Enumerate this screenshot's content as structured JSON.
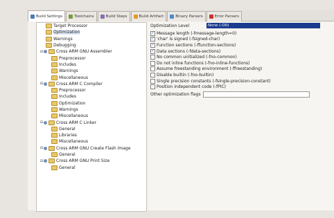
{
  "tabs": [
    {
      "label": "Build Settings",
      "icon": "gear-icon",
      "color": "#4a7ab5",
      "active": true
    },
    {
      "label": "Toolchains",
      "icon": "toolchain-icon",
      "color": "#7a9a3c",
      "active": false
    },
    {
      "label": "Build Steps",
      "icon": "steps-icon",
      "color": "#8b6db0",
      "active": false
    },
    {
      "label": "Build Artifact",
      "icon": "artifact-icon",
      "color": "#e39a2b",
      "active": false
    },
    {
      "label": "Binary Parsers",
      "icon": "binary-icon",
      "color": "#4f8ac7",
      "active": false
    },
    {
      "label": "Error Parsers",
      "icon": "error-icon",
      "color": "#c8322e",
      "active": false
    }
  ],
  "tree": [
    {
      "label": "Target Processor",
      "depth": 1,
      "expander": ""
    },
    {
      "label": "Optimization",
      "depth": 1,
      "expander": "",
      "selected": true
    },
    {
      "label": "Warnings",
      "depth": 1,
      "expander": ""
    },
    {
      "label": "Debugging",
      "depth": 1,
      "expander": ""
    },
    {
      "label": "Cross ARM GNU Assembler",
      "depth": 0,
      "expander": "⊟"
    },
    {
      "label": "Preprocessor",
      "depth": 2,
      "expander": ""
    },
    {
      "label": "Includes",
      "depth": 2,
      "expander": ""
    },
    {
      "label": "Warnings",
      "depth": 2,
      "expander": ""
    },
    {
      "label": "Miscellaneous",
      "depth": 2,
      "expander": ""
    },
    {
      "label": "Cross ARM C Compiler",
      "depth": 0,
      "expander": "⊟"
    },
    {
      "label": "Preprocessor",
      "depth": 2,
      "expander": ""
    },
    {
      "label": "Includes",
      "depth": 2,
      "expander": ""
    },
    {
      "label": "Optimization",
      "depth": 2,
      "expander": ""
    },
    {
      "label": "Warnings",
      "depth": 2,
      "expander": ""
    },
    {
      "label": "Miscellaneous",
      "depth": 2,
      "expander": ""
    },
    {
      "label": "Cross ARM C Linker",
      "depth": 0,
      "expander": "⊟"
    },
    {
      "label": "General",
      "depth": 2,
      "expander": ""
    },
    {
      "label": "Libraries",
      "depth": 2,
      "expander": ""
    },
    {
      "label": "Miscellaneous",
      "depth": 2,
      "expander": ""
    },
    {
      "label": "Cross ARM GNU Create Flash Image",
      "depth": 0,
      "expander": "⊟"
    },
    {
      "label": "General",
      "depth": 2,
      "expander": ""
    },
    {
      "label": "Cross ARM GNU Print Size",
      "depth": 0,
      "expander": "⊟"
    },
    {
      "label": "General",
      "depth": 2,
      "expander": ""
    }
  ],
  "optimization": {
    "level_label": "Optimization Level",
    "level_value": "None (-O0)",
    "options": [
      {
        "label": "Message length (-fmessage-length=0)",
        "checked": true
      },
      {
        "label": "'char' is signed (-fsigned-char)",
        "checked": true
      },
      {
        "label": "Function sections (-ffunction-sections)",
        "checked": true
      },
      {
        "label": "Data sections (-fdata-sections)",
        "checked": true
      },
      {
        "label": "No common unitialized (-fno-common)",
        "checked": false
      },
      {
        "label": "Do not inline functions (-fno-inline-functions)",
        "checked": false
      },
      {
        "label": "Assume freestanding environment (-ffreestanding)",
        "checked": false
      },
      {
        "label": "Disable builtin (-fno-builtin)",
        "checked": false
      },
      {
        "label": "Single precision constants (-fsingle-precision-constant)",
        "checked": false
      },
      {
        "label": "Position independent code (-fPIC)",
        "checked": false
      }
    ],
    "flags_label": "Other optimization flags"
  }
}
